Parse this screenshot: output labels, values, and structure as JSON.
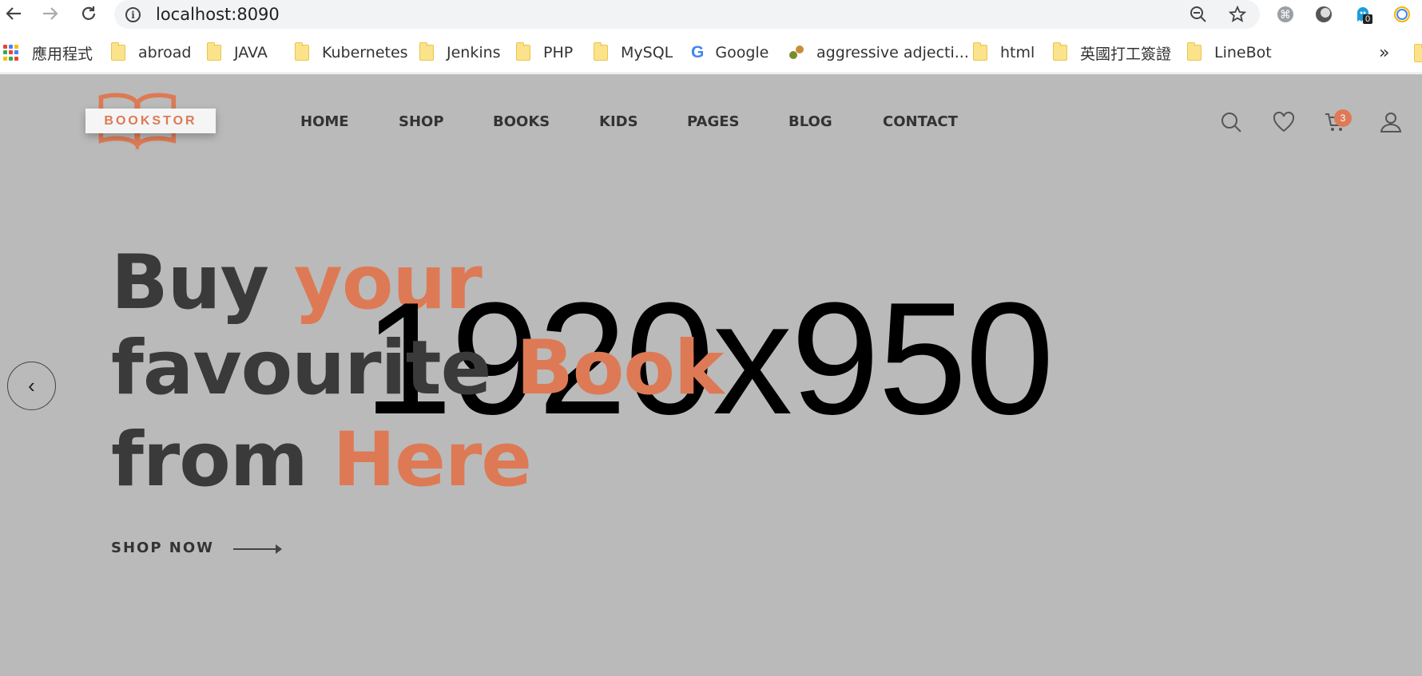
{
  "browser": {
    "url": "localhost:8090",
    "zoom_icon": "zoom-out-icon",
    "ext_badge": "0"
  },
  "bookmarks": [
    {
      "label": "應用程式",
      "kind": "apps"
    },
    {
      "label": "abroad",
      "kind": "folder"
    },
    {
      "label": "JAVA",
      "kind": "folder"
    },
    {
      "label": "Kubernetes",
      "kind": "folder"
    },
    {
      "label": "Jenkins",
      "kind": "folder"
    },
    {
      "label": "PHP",
      "kind": "folder"
    },
    {
      "label": "MySQL",
      "kind": "folder"
    },
    {
      "label": "Google",
      "kind": "google"
    },
    {
      "label": "aggressive adjecti...",
      "kind": "site"
    },
    {
      "label": "html",
      "kind": "folder"
    },
    {
      "label": "英國打工簽證",
      "kind": "folder"
    },
    {
      "label": "LineBot",
      "kind": "folder"
    }
  ],
  "bookmarks_more": "»",
  "site": {
    "logo_text": "BOOKSTOR",
    "nav": [
      "HOME",
      "SHOP",
      "BOOKS",
      "KIDS",
      "PAGES",
      "BLOG",
      "CONTACT"
    ],
    "cart_count": "3"
  },
  "hero": {
    "line1": {
      "dark": "Buy ",
      "accent": "your"
    },
    "line2": {
      "dark": "favourite ",
      "accent": "Book"
    },
    "line3": {
      "dark": "from ",
      "accent": "Here"
    },
    "cta": "SHOP NOW",
    "placeholder_text": "1920x950",
    "prev_arrow": "‹"
  },
  "colors": {
    "accent": "#dd7a55",
    "hero_bg": "#bababa",
    "text_dark": "#3a3a3a"
  }
}
